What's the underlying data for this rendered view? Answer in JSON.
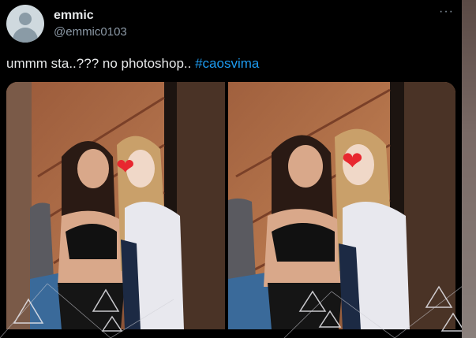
{
  "tweet": {
    "display_name": "emmic",
    "handle": "@emmic0103",
    "more_icon": "more-horizontal-icon",
    "text_main": "ummm sta..??? no photoshop.. ",
    "hashtag": "#caosvima"
  },
  "media": {
    "count": 2,
    "heart_emoji": "❤"
  },
  "colors": {
    "background": "#000000",
    "text": "#e7e9ea",
    "secondary": "#8b98a5",
    "link": "#1d9bf0"
  }
}
